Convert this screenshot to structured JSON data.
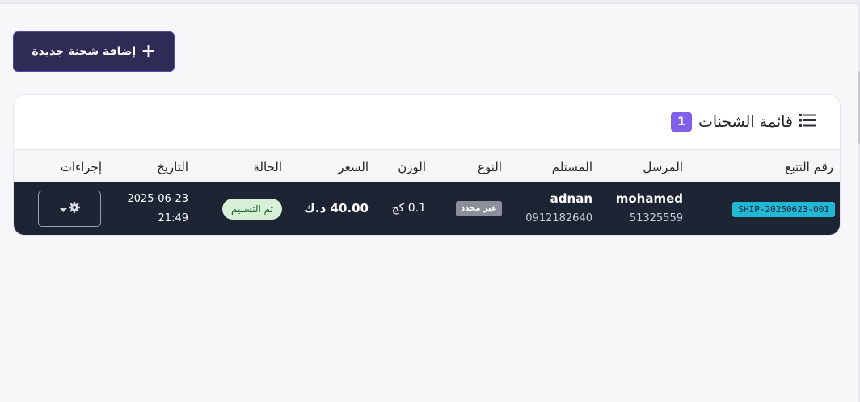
{
  "toolbar": {
    "add_plus": "+",
    "add_label": "إضافة شحنة جديدة"
  },
  "card": {
    "title": "قائمة الشحنات",
    "count": "1",
    "list_icon": "list-icon"
  },
  "table": {
    "columns": [
      "رقم التتبع",
      "المرسل",
      "المستلم",
      "النوع",
      "الوزن",
      "السعر",
      "الحالة",
      "التاريخ",
      "إجراءات"
    ],
    "rows": [
      {
        "tracking": "SHIP-20250623-001",
        "sender_name": "mohamed",
        "sender_phone": "51325559",
        "recipient_name": "adnan",
        "recipient_phone": "0912182640",
        "type": "غير محدد",
        "weight": "0.1 كج",
        "price": "40.00 د.ك",
        "status": "تم التسليم",
        "date": "2025-06-23",
        "time": "21:49",
        "actions_icon": "gear-icon",
        "caret_icon": "caret-down-icon"
      }
    ]
  },
  "colors": {
    "primary": "#2e2b57",
    "badge": "#8060e8",
    "row_bg": "#1d2433",
    "tracking_bg": "#21b8d6",
    "status_bg": "#d6f1d8"
  }
}
